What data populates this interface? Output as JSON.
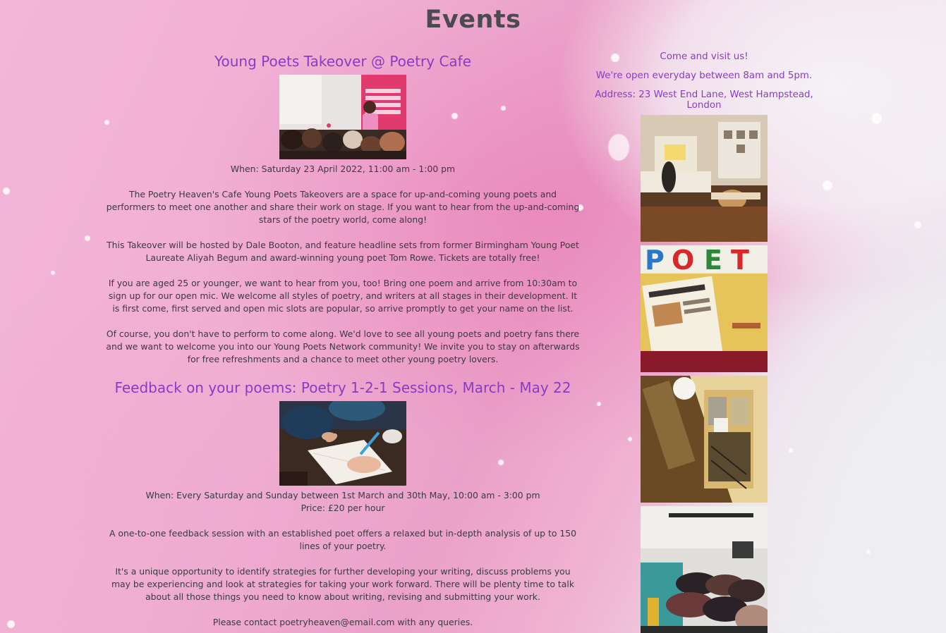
{
  "page": {
    "title": "Events"
  },
  "events": [
    {
      "title": "Young Poets Takeover @ Poetry Cafe",
      "image_desc": "young-poet-performing-photo",
      "when": "When: Saturday 23 April 2022, 11:00 am - 1:00 pm",
      "paragraphs": [
        "The Poetry Heaven's Cafe Young Poets Takeovers are a space for up-and-coming young poets and performers to meet one another and share their work on stage. If you want to hear from the up-and-coming stars of the poetry world, come along!",
        "This Takeover will be hosted by Dale Booton, and feature headline sets from former Birmingham Young Poet Laureate Aliyah Begum and award-winning young poet Tom Rowe. Tickets are totally free!",
        "If you are aged 25 or younger, we want to hear from you, too! Bring one poem and arrive from 10:30am to sign up for our open mic. We welcome all styles of poetry, and writers at all stages in their development. It is first come, first served and open mic slots are popular, so arrive promptly to get your name on the list.",
        "Of course, you don't have to perform to come along. We'd love to see all young poets and poetry fans there and we want to welcome you into our Young Poets Network community! We invite you to stay on afterwards for free refreshments and a chance to meet other young poetry lovers."
      ]
    },
    {
      "title": "Feedback on your poems: Poetry 1-2-1 Sessions, March - May 22",
      "image_desc": "writing-feedback-photo",
      "when": "When: Every Saturday and Sunday between 1st March and 30th May, 10:00 am - 3:00 pm",
      "price": "Price: £20 per hour",
      "paragraphs": [
        "A one-to-one feedback session with an established poet offers a relaxed but in-depth analysis of up to 150 lines of your poetry.",
        "It's a unique opportunity to identify strategies for further developing your writing, discuss problems you may be experiencing and look at strategies for taking your work forward. There will be plenty time to talk about all those things you need to know about writing, revising and submitting your work.",
        "Please contact poetryheaven@email.com with any queries."
      ]
    }
  ],
  "sidebar": {
    "visit_heading": "Come and visit us!",
    "hours": "We're open everyday between 8am and 5pm.",
    "address": "Address: 23 West End Lane, West Hampstead, London"
  },
  "colors": {
    "accent": "#8a3bc4",
    "title": "#4a4a50",
    "body_text": "#3c3a40",
    "bg_pink": "#efaed2"
  }
}
